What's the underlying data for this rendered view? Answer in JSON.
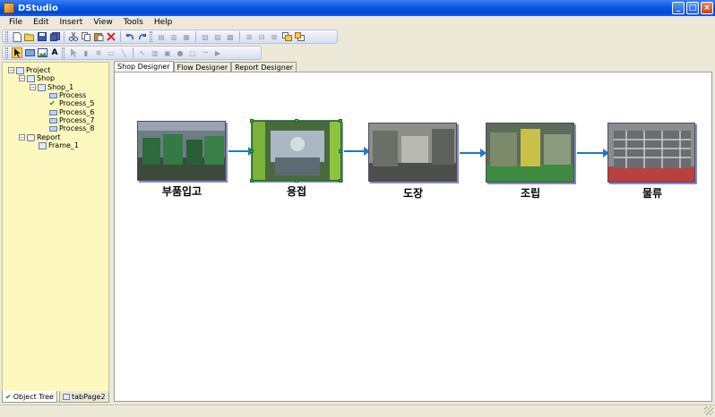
{
  "window": {
    "title": "DStudio",
    "controls": [
      "_",
      "□",
      "×"
    ]
  },
  "menu": [
    "File",
    "Edit",
    "Insert",
    "View",
    "Tools",
    "Help"
  ],
  "tree": {
    "root": "Project",
    "shop": "Shop",
    "shop1": "Shop_1",
    "processes": [
      "Process",
      "Process_5",
      "Process_6",
      "Process_7",
      "Process_8"
    ],
    "report": "Report",
    "frame": "Frame_1"
  },
  "left_tabs": [
    "Object Tree",
    "tabPage2"
  ],
  "main_tabs": [
    "Shop Designer",
    "Flow Designer",
    "Report Designer"
  ],
  "steps": [
    "부품입고",
    "용접",
    "도장",
    "조립",
    "물류"
  ],
  "colors": {
    "accent": "#1f79c4",
    "tree_bg": "#fcf8bf",
    "selection": "#35b035"
  }
}
